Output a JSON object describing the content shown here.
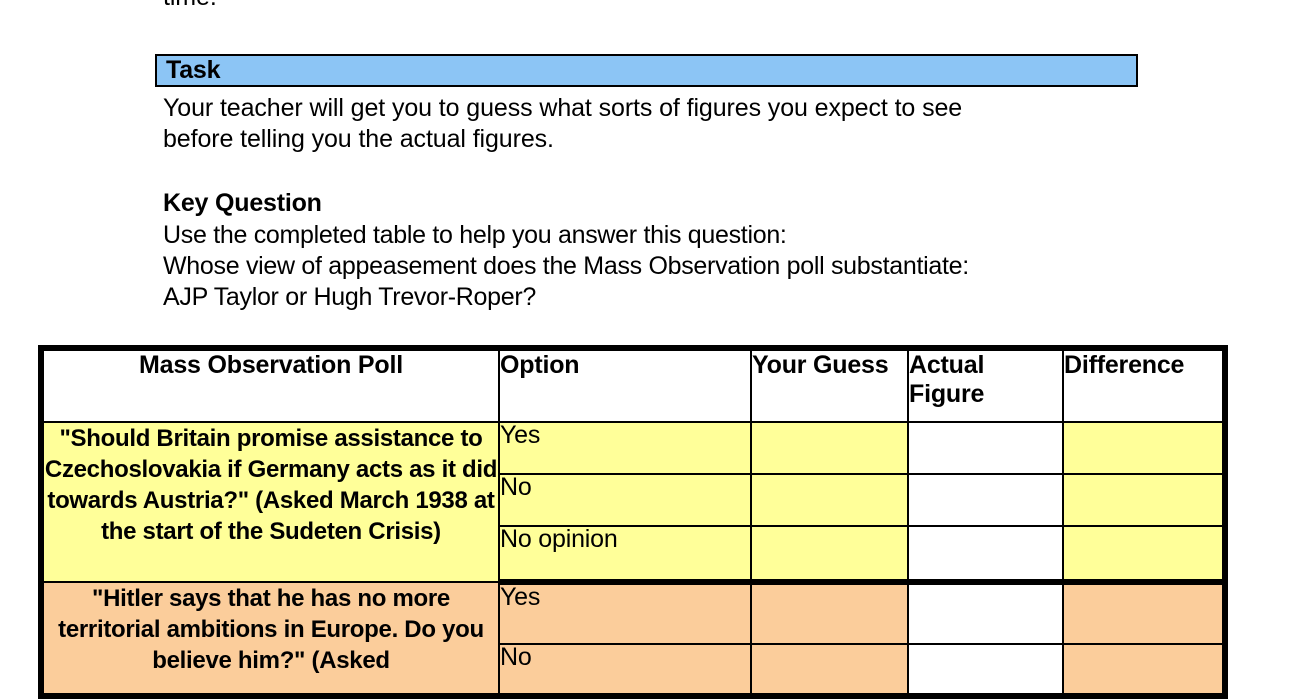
{
  "page": {
    "top_fragment": "time."
  },
  "task": {
    "heading": "Task",
    "body_line1": "Your teacher will get you to guess what sorts of figures you expect to see",
    "body_line2": "before telling you the actual figures.",
    "banner_color": "#8cc5f5"
  },
  "key_question": {
    "heading": "Key Question",
    "line1": "Use the completed table to help you answer this question:",
    "line2": "Whose view of appeasement does the Mass Observation poll substantiate:",
    "line3": "AJP Taylor or Hugh Trevor-Roper?"
  },
  "table": {
    "headers": {
      "poll": "Mass Observation Poll",
      "option": "Option",
      "your_guess": "Your Guess",
      "actual_figure": "Actual Figure",
      "difference": "Difference"
    },
    "colors": {
      "row1": "#ffff99",
      "row2": "#fbcd9b",
      "actual_figure_column": "#ffffff"
    },
    "rows": [
      {
        "question": "\"Should Britain promise assistance to Czechoslovakia if Germany acts as it did towards Austria?\" (Asked March 1938 at the start of the Sudeten Crisis)",
        "band": "yellow",
        "options": [
          {
            "label": "Yes",
            "your_guess": "",
            "actual_figure": "",
            "difference": ""
          },
          {
            "label": "No",
            "your_guess": "",
            "actual_figure": "",
            "difference": ""
          },
          {
            "label": "No opinion",
            "your_guess": "",
            "actual_figure": "",
            "difference": ""
          }
        ]
      },
      {
        "question": "\"Hitler says that he has no more territorial ambitions in Europe. Do you believe him?\" (Asked",
        "band": "orange",
        "options": [
          {
            "label": "Yes",
            "your_guess": "",
            "actual_figure": "",
            "difference": ""
          },
          {
            "label": "No",
            "your_guess": "",
            "actual_figure": "",
            "difference": ""
          }
        ]
      }
    ]
  }
}
